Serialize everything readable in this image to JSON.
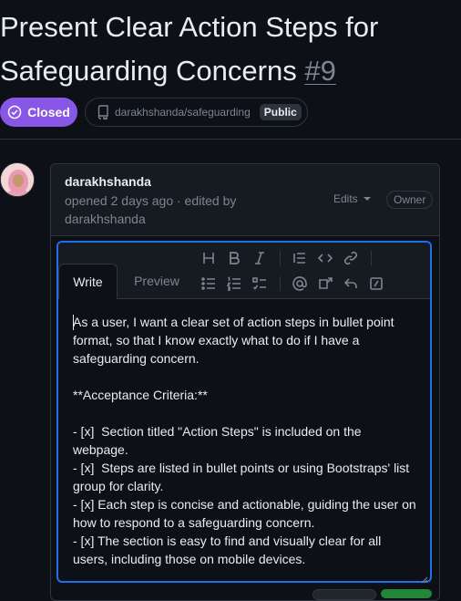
{
  "issue": {
    "title": "Present Clear Action Steps for Safeguarding Concerns",
    "number": "#9",
    "state_label": "Closed",
    "repo": "darakhshanda/safeguarding",
    "visibility": "Public"
  },
  "comment": {
    "author": "darakhshanda",
    "meta": "opened 2 days ago · edited by darakhshanda",
    "edits_label": "Edits",
    "role_badge": "Owner"
  },
  "editor": {
    "tabs": [
      "Write",
      "Preview"
    ],
    "active_tab": "Write",
    "toolbar_icons": [
      "heading-icon",
      "bold-icon",
      "italic-icon",
      "quote-icon",
      "code-icon",
      "link-icon",
      "bulleted-list-icon",
      "numbered-list-icon",
      "task-list-icon",
      "mention-icon",
      "cross-reference-icon",
      "reply-icon",
      "slash-command-icon"
    ],
    "body": "As a user, I want a clear set of action steps in bullet point format, so that I know exactly what to do if I have a safeguarding concern.\n\n**Acceptance Criteria:**\n\n- [x]  Section titled \"Action Steps\" is included on the webpage.\n- [x]  Steps are listed in bullet points or using Bootstraps' list group for clarity.\n- [x] Each step is concise and actionable, guiding the user on how to respond to a safeguarding concern.\n- [x] The section is easy to find and visually clear for all users, including those on mobile devices."
  },
  "colors": {
    "background": "#0d1117",
    "closed_badge": "#8957e5",
    "focus_border": "#1f6feb",
    "muted_text": "#7d8590"
  }
}
